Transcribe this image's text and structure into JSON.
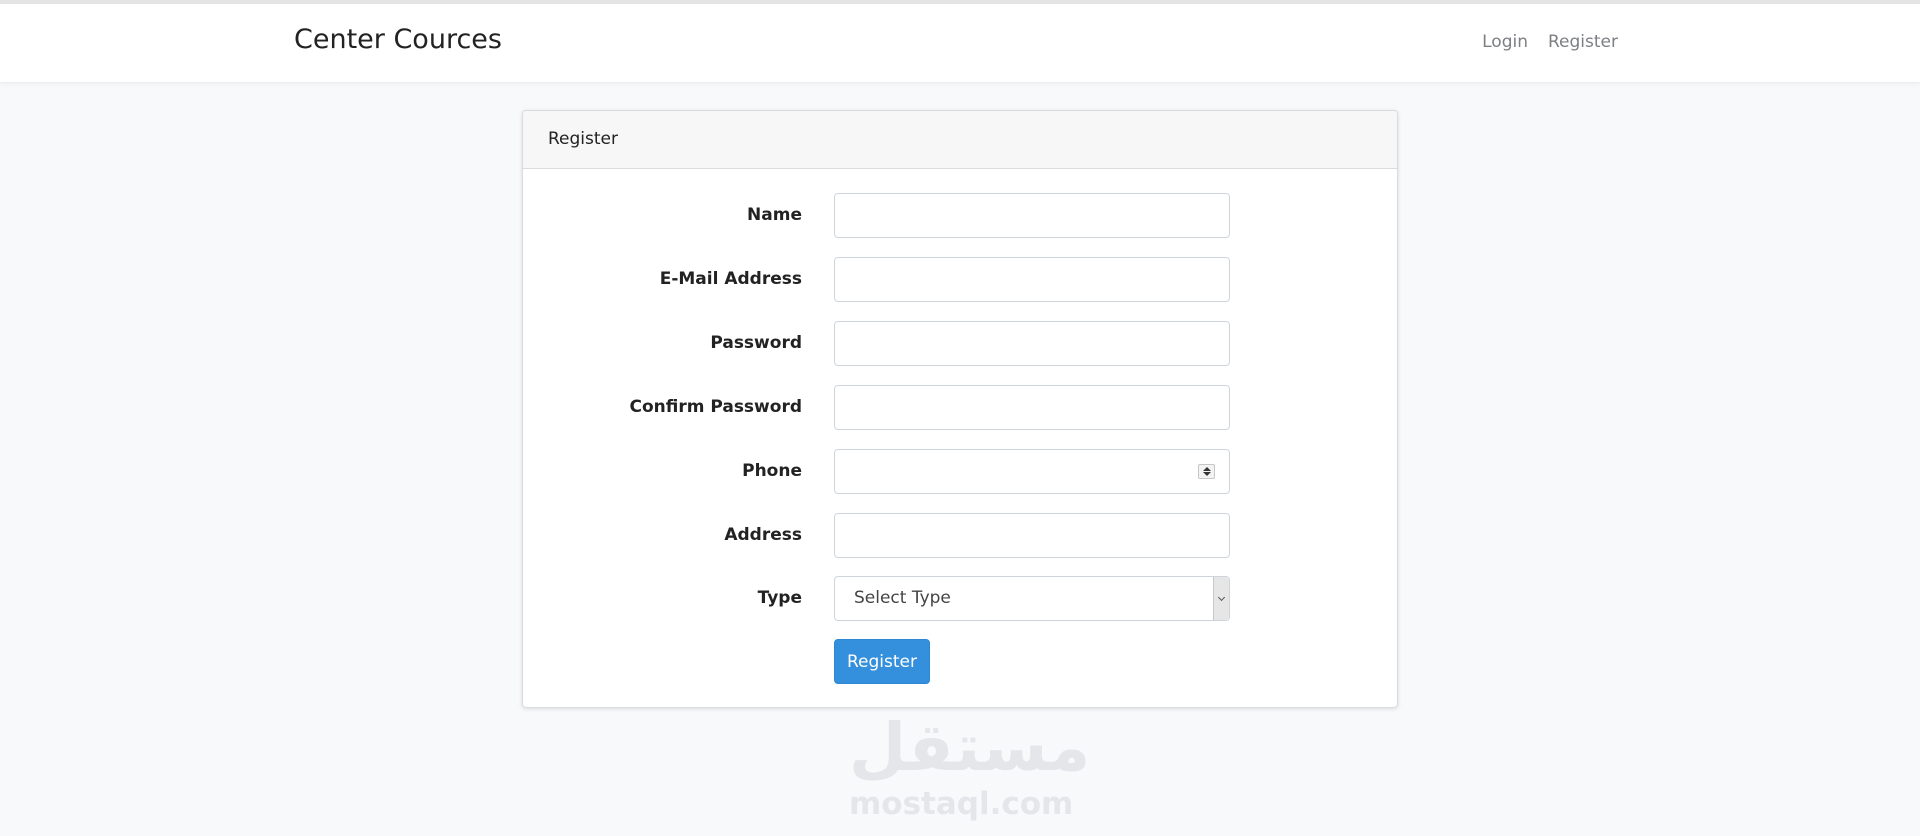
{
  "navbar": {
    "brand": "Center Cources",
    "links": [
      {
        "label": "Login"
      },
      {
        "label": "Register"
      }
    ]
  },
  "card": {
    "title": "Register",
    "fields": [
      {
        "label": "Name",
        "value": "",
        "placeholder": ""
      },
      {
        "label": "E-Mail Address",
        "value": "",
        "placeholder": ""
      },
      {
        "label": "Password",
        "value": "",
        "placeholder": ""
      },
      {
        "label": "Confirm Password",
        "value": "",
        "placeholder": ""
      },
      {
        "label": "Phone",
        "value": "",
        "placeholder": ""
      },
      {
        "label": "Address",
        "value": "",
        "placeholder": ""
      }
    ],
    "type_field": {
      "label": "Type",
      "selected": "Select Type"
    },
    "submit_label": "Register"
  },
  "watermark": {
    "arabic": "مستقل",
    "latin": "mostaql.com"
  },
  "colors": {
    "primary": "#3490dc",
    "background": "#f8f9fb",
    "navbar": "#ffffff"
  }
}
